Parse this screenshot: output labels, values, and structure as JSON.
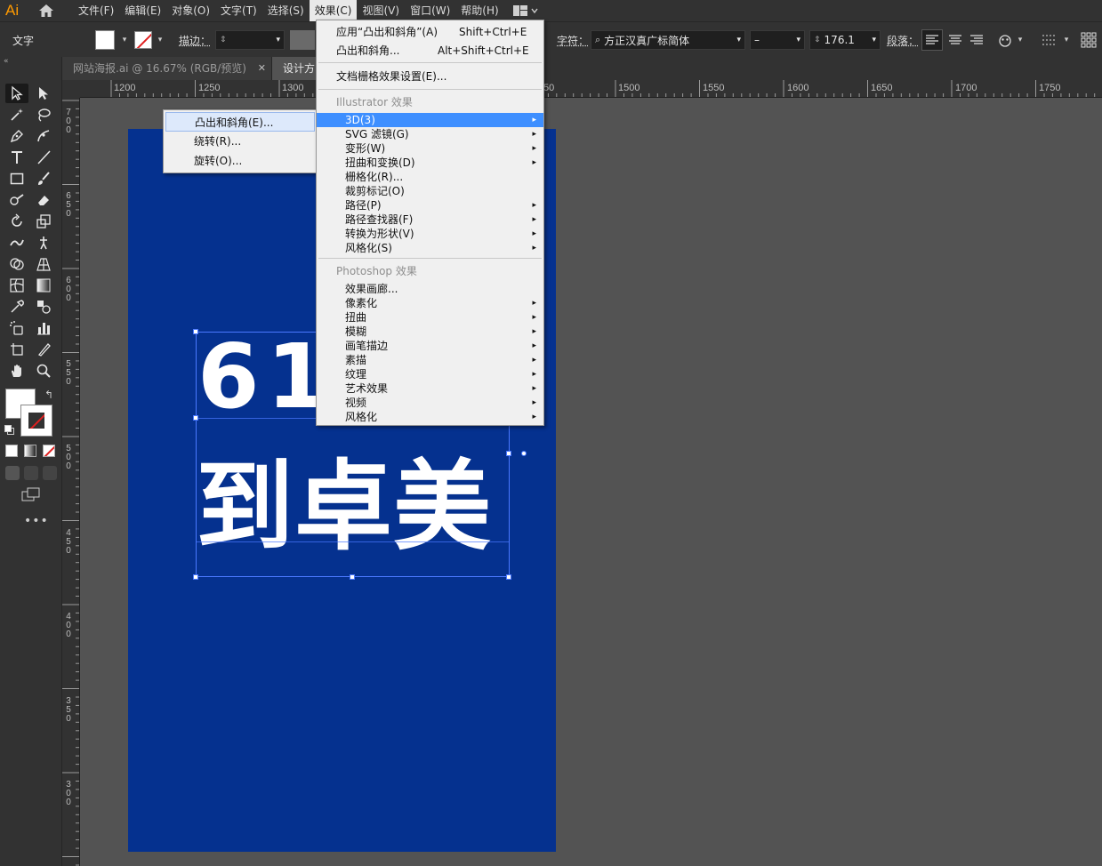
{
  "app": {
    "logo": "Ai"
  },
  "menubar": {
    "items": [
      "文件(F)",
      "编辑(E)",
      "对象(O)",
      "文字(T)",
      "选择(S)",
      "效果(C)",
      "视图(V)",
      "窗口(W)",
      "帮助(H)"
    ],
    "active": "效果(C)"
  },
  "control": {
    "type_label": "文字",
    "stroke_label": "描边：",
    "char_label": "字符：",
    "font_family": "方正汉真广标简体",
    "font_style": "–",
    "font_size": "176.1",
    "para_label": "段落："
  },
  "tabs": [
    {
      "label": "网站海报.ai @ 16.67% (RGB/预览)",
      "close": "✕",
      "active": false
    },
    {
      "label": "设计方",
      "active": true
    }
  ],
  "ruler": {
    "top": [
      "1200",
      "1250",
      "1300",
      "50",
      "1500",
      "1550",
      "1600",
      "1650",
      "1700",
      "1750"
    ],
    "left": [
      "700",
      "650",
      "600",
      "550",
      "500",
      "450",
      "400",
      "350",
      "300"
    ]
  },
  "artboard": {
    "color": "#05318f",
    "line1": "61",
    "line2": "到卓美"
  },
  "effect_menu": {
    "apply_last": "应用“凸出和斜角”(A)",
    "apply_last_shortcut": "Shift+Ctrl+E",
    "last_effect": "凸出和斜角...",
    "last_effect_shortcut": "Alt+Shift+Ctrl+E",
    "raster_settings": "文档栅格效果设置(E)...",
    "illustrator_header": "Illustrator 效果",
    "illustrator_items": [
      "3D(3)",
      "SVG 滤镜(G)",
      "变形(W)",
      "扭曲和变换(D)",
      "栅格化(R)...",
      "裁剪标记(O)",
      "路径(P)",
      "路径查找器(F)",
      "转换为形状(V)",
      "风格化(S)"
    ],
    "illustrator_submenu": [
      true,
      true,
      true,
      true,
      false,
      false,
      true,
      true,
      true,
      true
    ],
    "photoshop_header": "Photoshop 效果",
    "photoshop_items": [
      "效果画廊...",
      "像素化",
      "扭曲",
      "模糊",
      "画笔描边",
      "素描",
      "纹理",
      "艺术效果",
      "视频",
      "风格化"
    ],
    "photoshop_submenu": [
      false,
      true,
      true,
      true,
      true,
      true,
      true,
      true,
      true,
      true
    ],
    "arrow": "▸"
  },
  "submenu_3d": {
    "items": [
      "凸出和斜角(E)...",
      "绕转(R)...",
      "旋转(O)..."
    ]
  },
  "colors": {
    "accent": "#3e8fff",
    "selection": "#4a78ff",
    "logo": "#ff9a00"
  }
}
